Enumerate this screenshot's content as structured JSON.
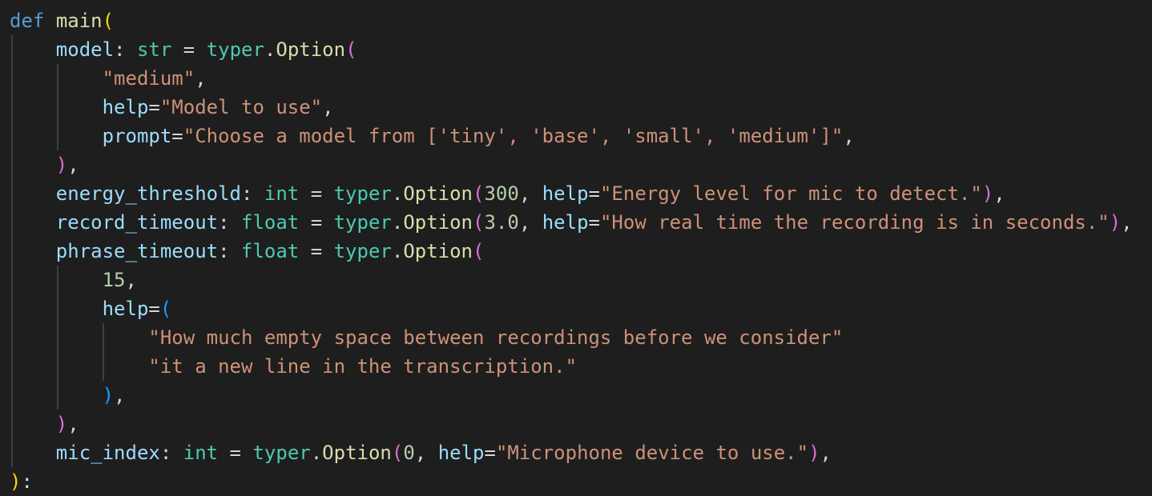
{
  "code": {
    "lines": [
      [
        [
          "kw",
          "def"
        ],
        [
          "op",
          " "
        ],
        [
          "fn",
          "main"
        ],
        [
          "b1",
          "("
        ]
      ],
      [
        [
          "op",
          "    "
        ],
        [
          "param",
          "model"
        ],
        [
          "op",
          ": "
        ],
        [
          "type",
          "str"
        ],
        [
          "op",
          " = "
        ],
        [
          "cls",
          "typer"
        ],
        [
          "op",
          "."
        ],
        [
          "fn",
          "Option"
        ],
        [
          "b2",
          "("
        ]
      ],
      [
        [
          "op",
          "        "
        ],
        [
          "str",
          "\"medium\""
        ],
        [
          "op",
          ","
        ]
      ],
      [
        [
          "op",
          "        "
        ],
        [
          "param",
          "help"
        ],
        [
          "op",
          "="
        ],
        [
          "str",
          "\"Model to use\""
        ],
        [
          "op",
          ","
        ]
      ],
      [
        [
          "op",
          "        "
        ],
        [
          "param",
          "prompt"
        ],
        [
          "op",
          "="
        ],
        [
          "str",
          "\"Choose a model from ['tiny', 'base', 'small', 'medium']\""
        ],
        [
          "op",
          ","
        ]
      ],
      [
        [
          "op",
          "    "
        ],
        [
          "b2",
          ")"
        ],
        [
          "op",
          ","
        ]
      ],
      [
        [
          "op",
          "    "
        ],
        [
          "param",
          "energy_threshold"
        ],
        [
          "op",
          ": "
        ],
        [
          "type",
          "int"
        ],
        [
          "op",
          " = "
        ],
        [
          "cls",
          "typer"
        ],
        [
          "op",
          "."
        ],
        [
          "fn",
          "Option"
        ],
        [
          "b2",
          "("
        ],
        [
          "num",
          "300"
        ],
        [
          "op",
          ", "
        ],
        [
          "param",
          "help"
        ],
        [
          "op",
          "="
        ],
        [
          "str",
          "\"Energy level for mic to detect.\""
        ],
        [
          "b2",
          ")"
        ],
        [
          "op",
          ","
        ]
      ],
      [
        [
          "op",
          "    "
        ],
        [
          "param",
          "record_timeout"
        ],
        [
          "op",
          ": "
        ],
        [
          "type",
          "float"
        ],
        [
          "op",
          " = "
        ],
        [
          "cls",
          "typer"
        ],
        [
          "op",
          "."
        ],
        [
          "fn",
          "Option"
        ],
        [
          "b2",
          "("
        ],
        [
          "num",
          "3.0"
        ],
        [
          "op",
          ", "
        ],
        [
          "param",
          "help"
        ],
        [
          "op",
          "="
        ],
        [
          "str",
          "\"How real time the recording is in seconds.\""
        ],
        [
          "b2",
          ")"
        ],
        [
          "op",
          ","
        ]
      ],
      [
        [
          "op",
          "    "
        ],
        [
          "param",
          "phrase_timeout"
        ],
        [
          "op",
          ": "
        ],
        [
          "type",
          "float"
        ],
        [
          "op",
          " = "
        ],
        [
          "cls",
          "typer"
        ],
        [
          "op",
          "."
        ],
        [
          "fn",
          "Option"
        ],
        [
          "b2",
          "("
        ]
      ],
      [
        [
          "op",
          "        "
        ],
        [
          "num",
          "15"
        ],
        [
          "op",
          ","
        ]
      ],
      [
        [
          "op",
          "        "
        ],
        [
          "param",
          "help"
        ],
        [
          "op",
          "="
        ],
        [
          "b3",
          "("
        ]
      ],
      [
        [
          "op",
          "            "
        ],
        [
          "str",
          "\"How much empty space between recordings before we consider\""
        ]
      ],
      [
        [
          "op",
          "            "
        ],
        [
          "str",
          "\"it a new line in the transcription.\""
        ]
      ],
      [
        [
          "op",
          "        "
        ],
        [
          "b3",
          ")"
        ],
        [
          "op",
          ","
        ]
      ],
      [
        [
          "op",
          "    "
        ],
        [
          "b2",
          ")"
        ],
        [
          "op",
          ","
        ]
      ],
      [
        [
          "op",
          "    "
        ],
        [
          "param",
          "mic_index"
        ],
        [
          "op",
          ": "
        ],
        [
          "type",
          "int"
        ],
        [
          "op",
          " = "
        ],
        [
          "cls",
          "typer"
        ],
        [
          "op",
          "."
        ],
        [
          "fn",
          "Option"
        ],
        [
          "b2",
          "("
        ],
        [
          "num",
          "0"
        ],
        [
          "op",
          ", "
        ],
        [
          "param",
          "help"
        ],
        [
          "op",
          "="
        ],
        [
          "str",
          "\"Microphone device to use.\""
        ],
        [
          "b2",
          ")"
        ],
        [
          "op",
          ","
        ]
      ],
      [
        [
          "b1",
          ")"
        ],
        [
          "op",
          ":"
        ]
      ]
    ]
  }
}
